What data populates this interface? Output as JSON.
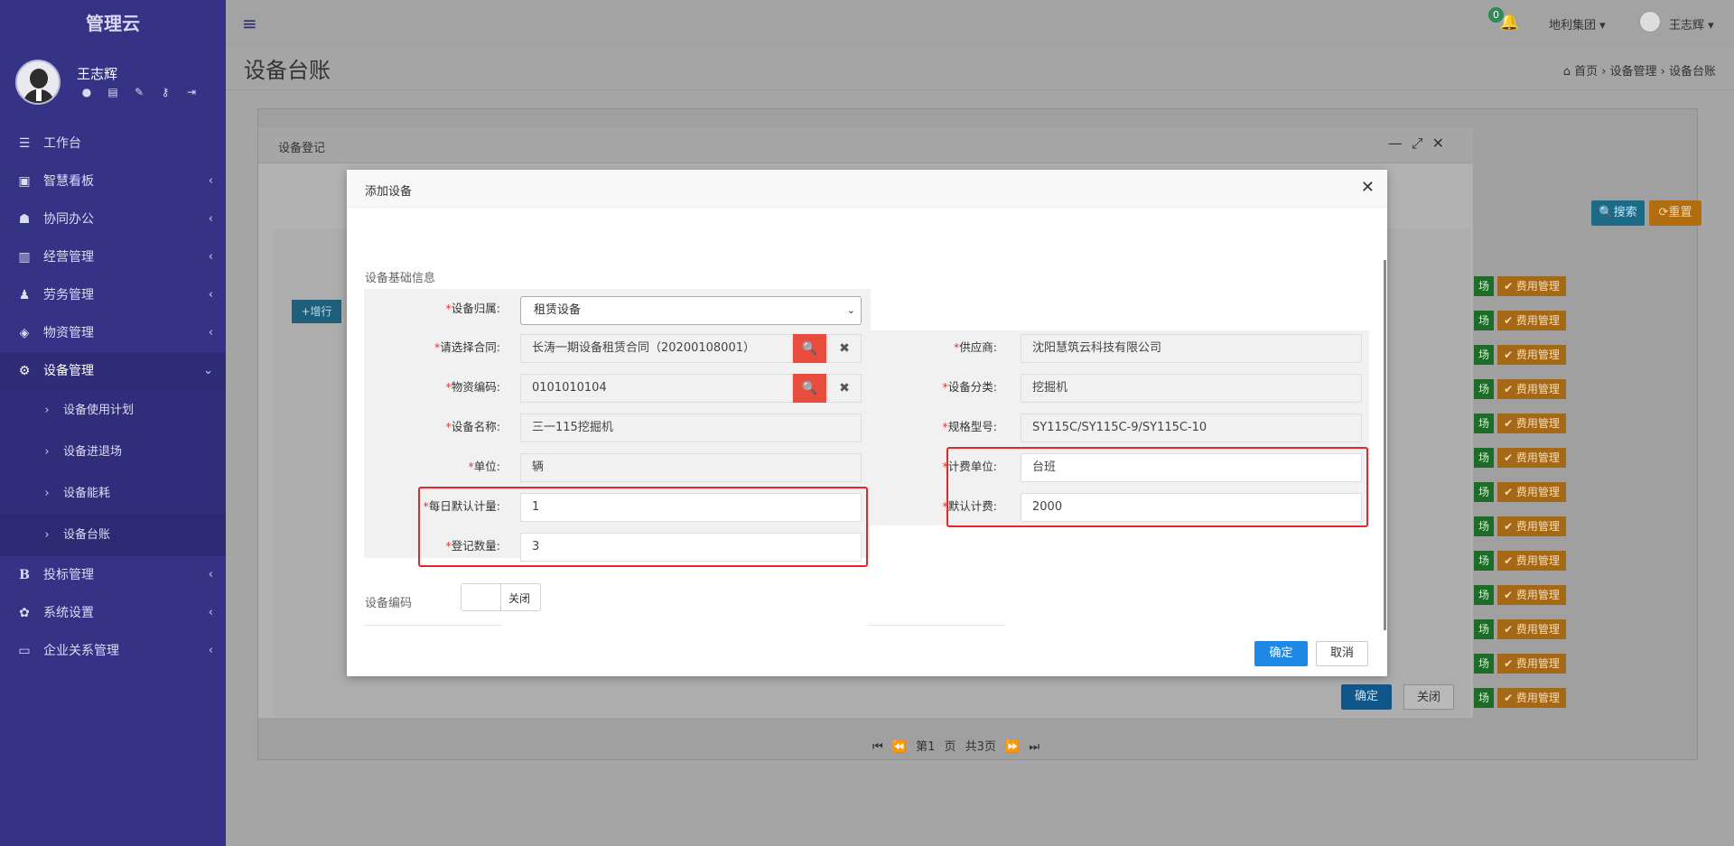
{
  "sidebar": {
    "brand": "管理云",
    "user_name": "王志辉",
    "items": [
      {
        "label": "工作台",
        "icon": "dashboard-icon",
        "glyph": "☰"
      },
      {
        "label": "智慧看板",
        "icon": "monitor-board-icon",
        "glyph": "▣"
      },
      {
        "label": "协同办公",
        "icon": "users-icon",
        "glyph": "👥"
      },
      {
        "label": "经营管理",
        "icon": "bar-chart-icon",
        "glyph": "▥"
      },
      {
        "label": "劳务管理",
        "icon": "worker-icon",
        "glyph": "♟"
      },
      {
        "label": "物资管理",
        "icon": "cube-icon",
        "glyph": "◈"
      },
      {
        "label": "设备管理",
        "icon": "gears-icon",
        "glyph": "⚙"
      },
      {
        "label": "投标管理",
        "icon": "bold-b-icon",
        "glyph": "B"
      },
      {
        "label": "系统设置",
        "icon": "settings-icon",
        "glyph": "✿"
      },
      {
        "label": "企业关系管理",
        "icon": "desktop-icon",
        "glyph": "▭"
      }
    ],
    "subitems": [
      "设备使用计划",
      "设备进退场",
      "设备能耗",
      "设备台账"
    ]
  },
  "topbar": {
    "notification_count": "0",
    "company": "地利集团 ▾",
    "user": "王志辉 ▾"
  },
  "page": {
    "title": "设备台账",
    "breadcrumb": "⌂ 首页  ›  设备管理  ›  设备台账"
  },
  "background": {
    "search_label": "🔍搜索",
    "reset_label": "⟳重置",
    "row_green": "场",
    "row_orange": "✔ 费用管理",
    "pager": "⏮ ⏪ 第1 页 共3页 ⏩ ⏭"
  },
  "outer_dialog": {
    "title": "设备登记",
    "add_row": "+增行",
    "confirm": "确定",
    "close": "关闭"
  },
  "modal": {
    "title": "添加设备",
    "section": "设备基础信息",
    "fields": {
      "ownership_label": "设备归属:",
      "ownership_value": "租赁设备",
      "contract_label": "请选择合同:",
      "contract_value": "长涛一期设备租赁合同（20200108001）",
      "material_code_label": "物资编码:",
      "material_code_value": "0101010104",
      "name_label": "设备名称:",
      "name_value": "三一115挖掘机",
      "unit_label": "单位:",
      "unit_value": "辆",
      "daily_label": "每日默认计量:",
      "daily_value": "1",
      "count_label": "登记数量:",
      "count_value": "3",
      "supplier_label": "供应商:",
      "supplier_value": "沈阳慧筑云科技有限公司",
      "category_label": "设备分类:",
      "category_value": "挖掘机",
      "spec_label": "规格型号:",
      "spec_value": "SY115C/SY115C-9/SY115C-10",
      "billing_unit_label": "计费单位:",
      "billing_unit_value": "台班",
      "fee_label": "默认计费:",
      "fee_value": "2000"
    },
    "code_label": "设备编码",
    "toggle_label": "关闭",
    "confirm": "确定",
    "cancel": "取消"
  },
  "colors": {
    "sidebar": "#353386",
    "danger": "#e74c3c",
    "primary": "#1e88e5",
    "highlight": "#e8262a"
  }
}
